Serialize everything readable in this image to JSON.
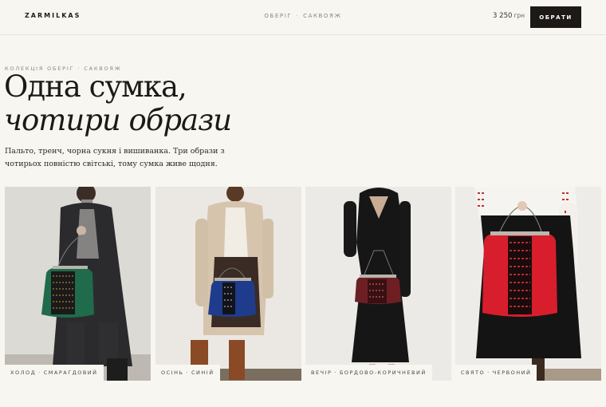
{
  "header": {
    "logo": "ZARMILKAS",
    "breadcrumb": [
      "ОБЕРІГ",
      "САКВОЯЖ"
    ],
    "breadcrumb_sep": "·",
    "price": "3 250",
    "currency": "грн",
    "cta_label": "ОБРАТИ"
  },
  "hero": {
    "eyebrow": [
      "КОЛЕКЦІЯ ОБЕРІГ",
      "САКВОЯЖ"
    ],
    "title_line1": "Одна сумка,",
    "title_line2": "чотири образи",
    "lead": "Пальто, тренч, чорна сукня і вишиванка. Три образи з чотирьох повністю світські, тому сумка живе щодня."
  },
  "looks": [
    {
      "mood": "ХОЛОД",
      "color": "СМАРАГДОВИЙ",
      "bag_hex": "#1f6b4c",
      "outfit_hex": "#2a2a2c"
    },
    {
      "mood": "ОСІНЬ",
      "color": "СИНІЙ",
      "bag_hex": "#1f3c8c",
      "outfit_hex": "#d9c7b1"
    },
    {
      "mood": "ВЕЧІР",
      "color": "БОРДОВО-КОРИЧНЕВИЙ",
      "bag_hex": "#6e1f24",
      "outfit_hex": "#151515"
    },
    {
      "mood": "СВЯТО",
      "color": "ЧЕРВОНИЙ",
      "bag_hex": "#d81e2c",
      "outfit_hex": "#141414"
    }
  ]
}
